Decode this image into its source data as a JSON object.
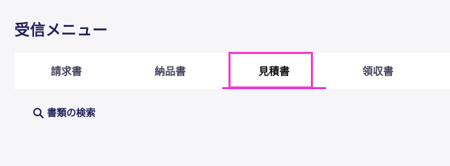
{
  "header": {
    "title": "受信メニュー"
  },
  "tabs": [
    {
      "label": "請求書",
      "active": false
    },
    {
      "label": "納品書",
      "active": false
    },
    {
      "label": "見積書",
      "active": true
    },
    {
      "label": "領収書",
      "active": false
    }
  ],
  "search": {
    "label": "書類の検索",
    "icon": "search-icon"
  },
  "colors": {
    "accent": "#e23dc4",
    "highlight": "#f03ccf",
    "title": "#1f1f5c",
    "background": "#f6f6f9"
  }
}
